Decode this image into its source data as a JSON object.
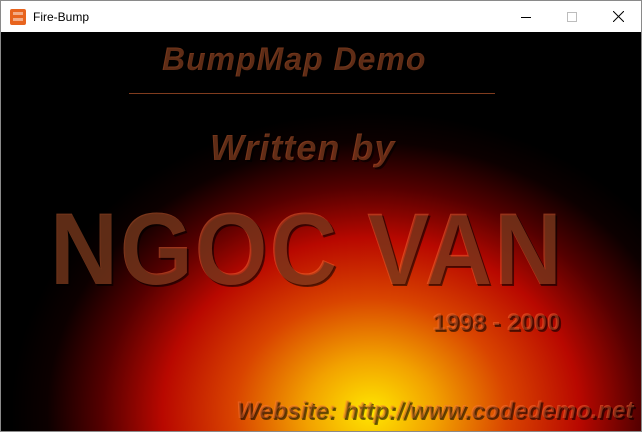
{
  "window": {
    "title": "Fire-Bump",
    "app_icon": "fire-bump-app-icon",
    "controls": [
      "minimize-icon",
      "maximize-icon",
      "close-icon"
    ]
  },
  "demo": {
    "heading": "BumpMap Demo",
    "written_by": "Written by",
    "author": "NGOC VAN",
    "years": "1998 - 2000",
    "website": "Website: http://www.codedemo.net"
  },
  "colors": {
    "fire_core": "#ffe600",
    "fire_mid": "#ff5000",
    "fire_outer": "#c80000",
    "background": "#000000"
  }
}
